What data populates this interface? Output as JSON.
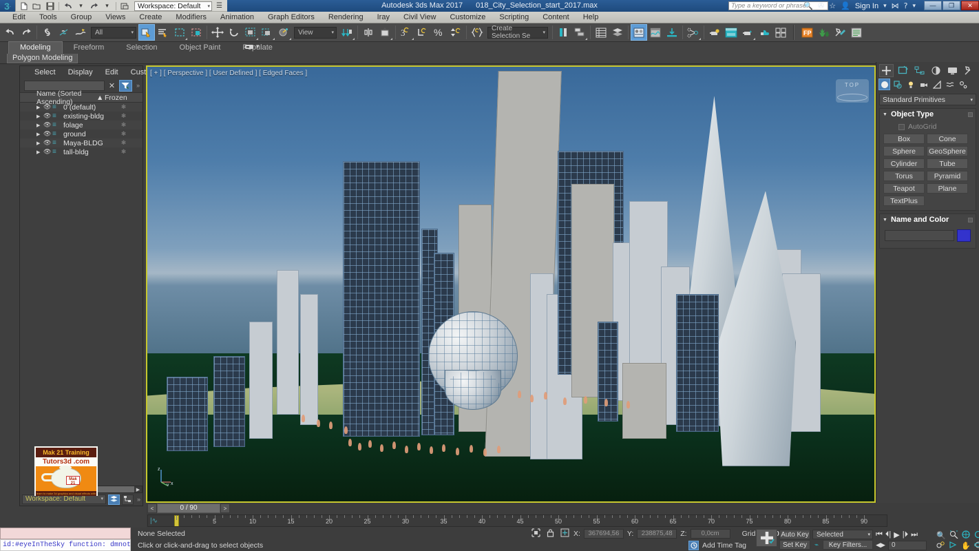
{
  "titlebar": {
    "app_title": "Autodesk 3ds Max 2017",
    "file_name": "018_City_Selection_start_2017.max",
    "workspace_label": "Workspace: Default",
    "search_placeholder": "Type a keyword or phrase",
    "signin_label": "Sign In",
    "min_label": "—",
    "max_label": "❐",
    "close_label": "✕"
  },
  "menubar": {
    "items": [
      "Edit",
      "Tools",
      "Group",
      "Views",
      "Create",
      "Modifiers",
      "Animation",
      "Graph Editors",
      "Rendering",
      "Iray",
      "Civil View",
      "Customize",
      "Scripting",
      "Content",
      "Help"
    ]
  },
  "toolbar": {
    "selection_filter": "All",
    "reference_coord": "View",
    "named_selection_set": "Create Selection Se"
  },
  "ribbon": {
    "tabs": [
      "Modeling",
      "Freeform",
      "Selection",
      "Object Paint",
      "Populate"
    ],
    "active_tab": "Modeling",
    "panel_label": "Polygon Modeling"
  },
  "explorer": {
    "menus": [
      "Select",
      "Display",
      "Edit",
      "Customize"
    ],
    "search_value": "",
    "columns": {
      "name": "Name (Sorted Ascending)",
      "sort_arrow": "▲",
      "frozen": "Frozen"
    },
    "rows": [
      {
        "name": "0 (default)"
      },
      {
        "name": "existing-bldg"
      },
      {
        "name": "folage"
      },
      {
        "name": "ground"
      },
      {
        "name": "Maya-BLDG"
      },
      {
        "name": "tall-bldg"
      }
    ],
    "workspace_label": "Workspace: Default"
  },
  "viewport": {
    "label_nav": "[ + ]",
    "label_view": "[ Perspective ]",
    "label_shading": "[ User Defined ]",
    "label_edged": "[ Edged Faces ]",
    "viewcube_label": "TOP",
    "axis_x": "x",
    "axis_y": "y",
    "axis_z": "z"
  },
  "logo": {
    "line1": "Mak 21 Training",
    "line2": "Tutors3d .com",
    "badge": "Mak 21",
    "line4": "learn to make 3d graphics and visual effects with max"
  },
  "command_panel": {
    "tabs": [
      "create-tab",
      "modify-tab",
      "hierarchy-tab",
      "motion-tab",
      "display-tab",
      "utilities-tab"
    ],
    "subtabs": [
      "geometry-icon",
      "shapes-icon",
      "lights-icon",
      "cameras-icon",
      "helpers-icon",
      "spacewarps-icon",
      "systems-icon"
    ],
    "category": "Standard Primitives",
    "object_type": {
      "title": "Object Type",
      "autogrid_label": "AutoGrid",
      "buttons": [
        "Box",
        "Cone",
        "Sphere",
        "GeoSphere",
        "Cylinder",
        "Tube",
        "Torus",
        "Pyramid",
        "Teapot",
        "Plane",
        "TextPlus"
      ]
    },
    "name_and_color": {
      "title": "Name and Color",
      "name_value": "",
      "color_hex": "#3333cc"
    }
  },
  "trackbar": {
    "current_frame": "0 / 90",
    "prev_label": "<",
    "next_label": ">",
    "ticks": [
      0,
      5,
      10,
      15,
      20,
      25,
      30,
      35,
      40,
      45,
      50,
      55,
      60,
      65,
      70,
      75,
      80,
      85,
      90
    ]
  },
  "statusbar": {
    "maxscript_listener": "id:#eyeInTheSky   function: dmnotif",
    "selection_status": "None Selected",
    "hint": "Click or click-and-drag to select objects",
    "x_label": "X:",
    "x_value": "367694,56",
    "y_label": "Y:",
    "y_value": "238875,48",
    "z_label": "Z:",
    "z_value": "0,0cm",
    "grid_label": "Grid =",
    "grid_value": "10,0cm",
    "add_time_tag": "Add Time Tag",
    "auto_key": "Auto Key",
    "set_key": "Set Key",
    "key_mode": "Selected",
    "key_filters": "Key Filters...",
    "frame_spinner": "0"
  }
}
